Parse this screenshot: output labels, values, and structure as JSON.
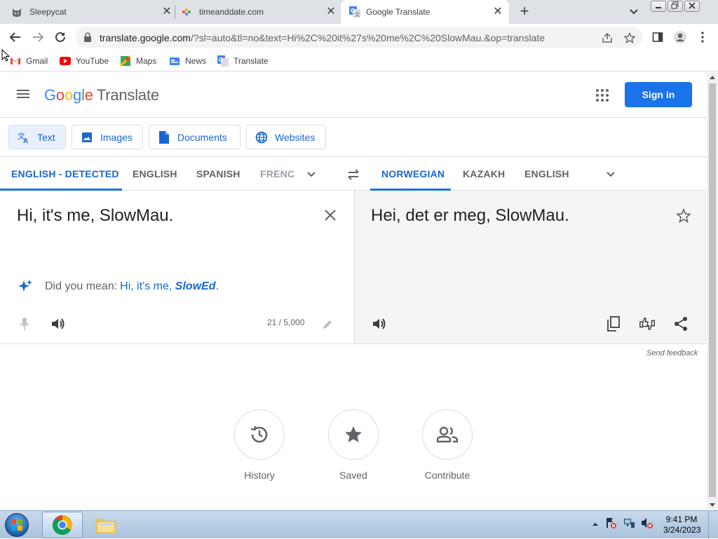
{
  "browser": {
    "tabs": [
      {
        "title": "Sleepycat",
        "icon": "cat-icon",
        "active": false
      },
      {
        "title": "timeanddate.com",
        "icon": "timeanddate-icon",
        "active": false
      },
      {
        "title": "Google Translate",
        "icon": "translate-icon",
        "active": true
      }
    ],
    "new_tab": "+",
    "url_main": "translate.google.com",
    "url_rest": "/?sl=auto&tl=no&text=Hi%2C%20it%27s%20me%2C%20SlowMau.&op=translate",
    "bookmarks": [
      {
        "label": "Gmail",
        "icon": "gmail-icon"
      },
      {
        "label": "YouTube",
        "icon": "youtube-icon"
      },
      {
        "label": "Maps",
        "icon": "maps-icon"
      },
      {
        "label": "News",
        "icon": "news-icon"
      },
      {
        "label": "Translate",
        "icon": "translate-icon"
      }
    ]
  },
  "header": {
    "logo_google": [
      "G",
      "o",
      "o",
      "g",
      "l",
      "e"
    ],
    "logo_product": "Translate",
    "signin_label": "Sign in"
  },
  "modes": [
    {
      "label": "Text",
      "icon": "text-translate-icon",
      "active": true
    },
    {
      "label": "Images",
      "icon": "image-icon",
      "active": false
    },
    {
      "label": "Documents",
      "icon": "document-icon",
      "active": false
    },
    {
      "label": "Websites",
      "icon": "globe-icon",
      "active": false
    }
  ],
  "source_langs": [
    "ENGLISH - DETECTED",
    "ENGLISH",
    "SPANISH",
    "FRENC"
  ],
  "target_langs": [
    "NORWEGIAN",
    "KAZAKH",
    "ENGLISH"
  ],
  "source": {
    "text": "Hi, it's me, SlowMau.",
    "did_you_mean_label": "Did you mean:",
    "suggestion_plain": "Hi, it's me, ",
    "suggestion_bold": "SlowEd",
    "suggestion_end": ".",
    "char_count": "21 / 5,000"
  },
  "target": {
    "text": "Hei, det er meg, SlowMau."
  },
  "send_feedback": "Send feedback",
  "bottom_buttons": [
    {
      "label": "History",
      "icon": "history-icon"
    },
    {
      "label": "Saved",
      "icon": "star-icon"
    },
    {
      "label": "Contribute",
      "icon": "people-icon"
    }
  ],
  "taskbar": {
    "time": "9:41 PM",
    "date": "3/24/2023"
  },
  "colors": {
    "accent": "#1a73e8",
    "link": "#1967d2",
    "target_bg": "#f5f5f5"
  }
}
